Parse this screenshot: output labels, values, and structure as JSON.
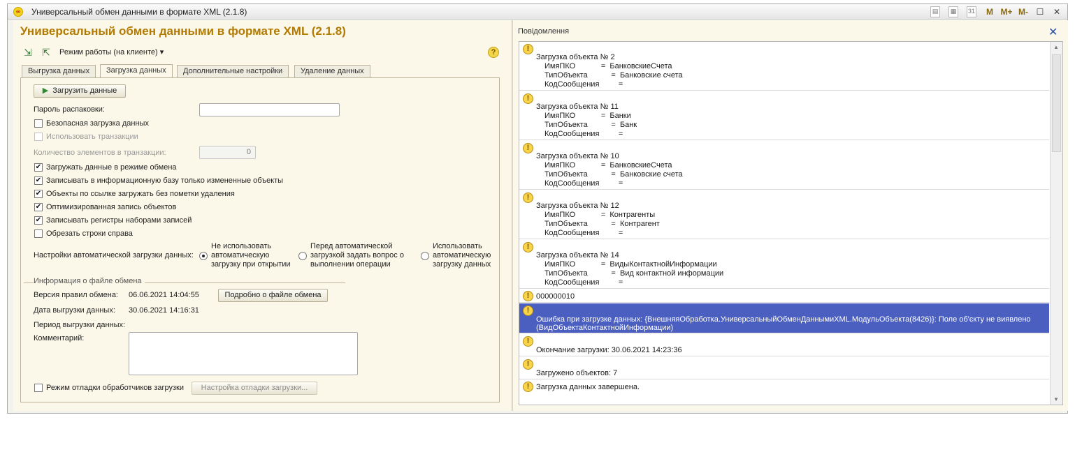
{
  "window": {
    "title": "Универсальный обмен данными в формате XML (2.1.8)"
  },
  "titlebar_buttons": {
    "m": "M",
    "mplus": "M+",
    "mminus": "M-",
    "close": "✕",
    "maximize": "☐",
    "calendar": "31"
  },
  "form": {
    "title": "Универсальный обмен данными в формате XML (2.1.8)",
    "mode_label": "Режим работы (на клиенте)",
    "help": "?"
  },
  "tabs": [
    {
      "label": "Выгрузка данных"
    },
    {
      "label": "Загрузка данных"
    },
    {
      "label": "Дополнительные настройки"
    },
    {
      "label": "Удаление данных"
    }
  ],
  "load_tab": {
    "load_button": "Загрузить данные",
    "password_label": "Пароль распаковки:",
    "password_value": "",
    "safe_load": {
      "label": "Безопасная загрузка данных",
      "checked": false
    },
    "use_transactions": {
      "label": "Использовать транзакции",
      "checked": false
    },
    "tx_count_label": "Количество элементов в транзакции:",
    "tx_count_value": "0",
    "options": [
      {
        "label": "Загружать данные в режиме обмена",
        "checked": true
      },
      {
        "label": "Записывать в информационную базу только измененные объекты",
        "checked": true
      },
      {
        "label": "Объекты по ссылке загружать без пометки удаления",
        "checked": true
      },
      {
        "label": "Оптимизированная запись объектов",
        "checked": true
      },
      {
        "label": "Записывать регистры наборами записей",
        "checked": true
      },
      {
        "label": "Обрезать строки справа",
        "checked": false
      }
    ],
    "auto_load_label": "Настройки автоматической загрузки данных:",
    "auto_load_options": [
      {
        "label": "Не использовать\nавтоматическую\nзагрузку при открытии",
        "selected": true
      },
      {
        "label": "Перед автоматической\nзагрузкой задать вопрос о\nвыполнении операции",
        "selected": false
      },
      {
        "label": "Использовать\nавтоматическую\nзагрузку данных",
        "selected": false
      }
    ],
    "file_info_group": "Информация о файле обмена",
    "rules_version_label": "Версия правил обмена:",
    "rules_version_value": "06.06.2021 14:04:55",
    "details_button": "Подробно о файле обмена",
    "export_date_label": "Дата выгрузки данных:",
    "export_date_value": "30.06.2021 14:16:31",
    "export_period_label": "Период выгрузки данных:",
    "comment_label": "Комментарий:",
    "comment_value": "",
    "debug_mode": {
      "label": "Режим отладки обработчиков загрузки",
      "checked": false
    },
    "debug_settings_button": "Настройка отладки загрузки..."
  },
  "messages_panel": {
    "title": "Повідомлення",
    "messages": [
      {
        "lines": [
          "Загрузка объекта № 2",
          "ИмяПКО            =  БанковскиеСчета",
          "ТипОбъекта           =  Банковские счета",
          "КодСообщения         ="
        ]
      },
      {
        "lines": [
          "Загрузка объекта № 11",
          "ИмяПКО            =  Банки",
          "ТипОбъекта           =  Банк",
          "КодСообщения         ="
        ]
      },
      {
        "lines": [
          "Загрузка объекта № 10",
          "ИмяПКО            =  БанковскиеСчета",
          "ТипОбъекта           =  Банковские счета",
          "КодСообщения         ="
        ]
      },
      {
        "lines": [
          "Загрузка объекта № 12",
          "ИмяПКО            =  Контрагенты",
          "ТипОбъекта           =  Контрагент",
          "КодСообщения         ="
        ]
      },
      {
        "lines": [
          "Загрузка объекта № 14",
          "ИмяПКО            =  ВидыКонтактнойИнформации",
          "ТипОбъекта           =  Вид контактной информации",
          "КодСообщения         ="
        ]
      },
      {
        "lines": [
          "000000010"
        ]
      },
      {
        "lines": [
          "Ошибка при загрузке данных: {ВнешняяОбработка.УниверсальныйОбменДаннымиXML.МодульОбъекта(8426)}: Поле об'єкту не виявлено",
          "(ВидОбъектаКонтактнойИнформации)"
        ]
      },
      {
        "lines": [
          "Окончание загрузки: 30.06.2021 14:23:36"
        ]
      },
      {
        "lines": [
          "Загружено объектов: 7"
        ]
      },
      {
        "lines": [
          "Загрузка данных завершена."
        ]
      }
    ]
  }
}
